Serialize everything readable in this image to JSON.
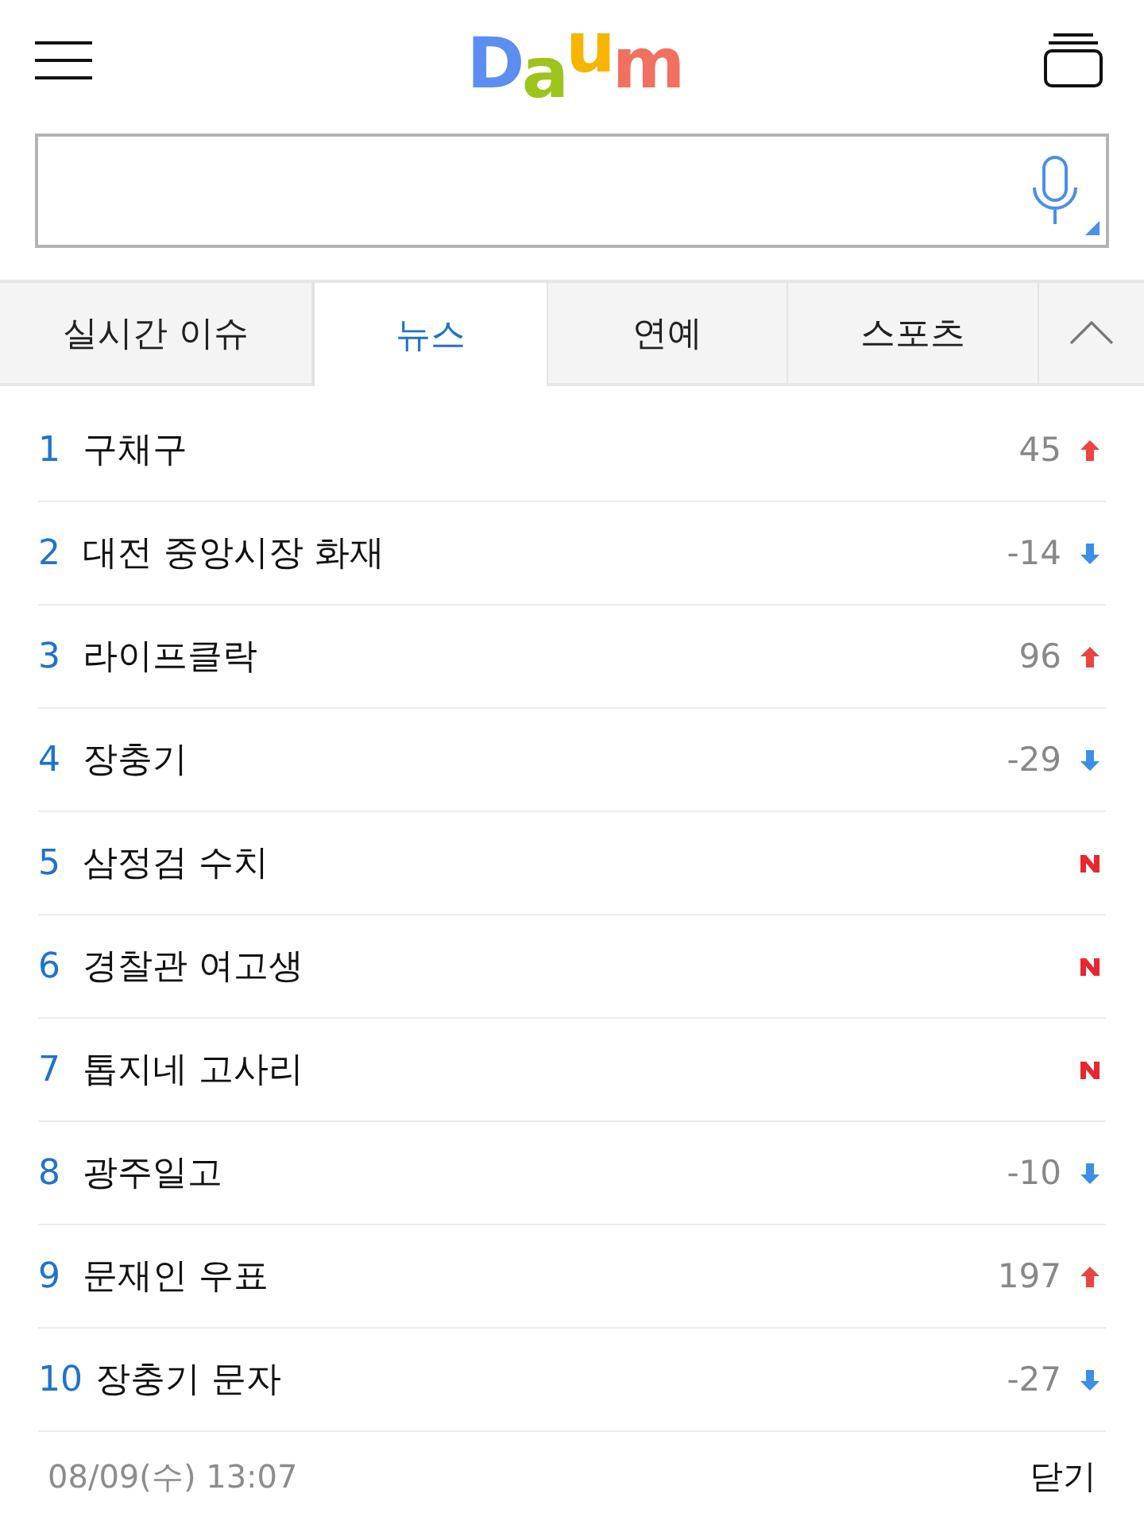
{
  "header": {
    "logo": [
      {
        "text": "D",
        "color": "#5b8ef0"
      },
      {
        "text": "a",
        "color": "#9dc41c"
      },
      {
        "text": "u",
        "color": "#f7b500"
      },
      {
        "text": "m",
        "color": "#f2705f"
      }
    ]
  },
  "tabs": [
    {
      "label": "실시간 이슈",
      "selected": false
    },
    {
      "label": "뉴스",
      "selected": true
    },
    {
      "label": "연예",
      "selected": false
    },
    {
      "label": "스포츠",
      "selected": false
    }
  ],
  "ranking": {
    "items": [
      {
        "rank": "1",
        "title": "구채구",
        "kind": "up",
        "change": "45"
      },
      {
        "rank": "2",
        "title": "대전 중앙시장 화재",
        "kind": "down",
        "change": "-14"
      },
      {
        "rank": "3",
        "title": "라이프클락",
        "kind": "up",
        "change": "96"
      },
      {
        "rank": "4",
        "title": "장충기",
        "kind": "down",
        "change": "-29"
      },
      {
        "rank": "5",
        "title": "삼정검 수치",
        "kind": "new"
      },
      {
        "rank": "6",
        "title": "경찰관 여고생",
        "kind": "new"
      },
      {
        "rank": "7",
        "title": "톱지네 고사리",
        "kind": "new"
      },
      {
        "rank": "8",
        "title": "광주일고",
        "kind": "down",
        "change": "-10"
      },
      {
        "rank": "9",
        "title": "문재인 우표",
        "kind": "up",
        "change": "197"
      },
      {
        "rank": "10",
        "title": "장충기 문자",
        "kind": "down",
        "change": "-27"
      }
    ]
  },
  "footer": {
    "timestamp": "08/09(수) 13:07",
    "close": "닫기"
  }
}
